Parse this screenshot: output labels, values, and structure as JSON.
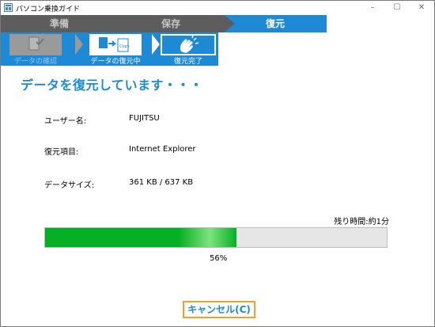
{
  "window": {
    "title": "パソコン乗換ガイド",
    "controls": {
      "minimize": "–",
      "maximize": "☐",
      "close": "✕"
    }
  },
  "steps": [
    {
      "label": "準備",
      "state": "done"
    },
    {
      "label": "保存",
      "state": "done"
    },
    {
      "label": "復元",
      "state": "active"
    }
  ],
  "substeps": [
    {
      "label": "データの確認",
      "icon": "document-check-icon",
      "state": "done"
    },
    {
      "label": "データの復元中",
      "icon": "copy-icon",
      "state": "active"
    },
    {
      "label": "復元完了",
      "icon": "applause-icon",
      "state": "pending"
    }
  ],
  "heading": "データを復元しています・・・",
  "info": {
    "user_label": "ユーザー名:",
    "user_value": "FUJITSU",
    "item_label": "復元項目:",
    "item_value": "Internet Explorer",
    "size_label": "データサイズ:",
    "size_value": "361 KB / 637 KB"
  },
  "progress": {
    "remaining": "残り時間:約1分",
    "percent_text": "56%",
    "fraction": 0.56
  },
  "cancel_label": "キャンセル(C)",
  "colors": {
    "accent": "#1e8ad6",
    "progress": "#06b025",
    "focus": "#f0a030"
  }
}
